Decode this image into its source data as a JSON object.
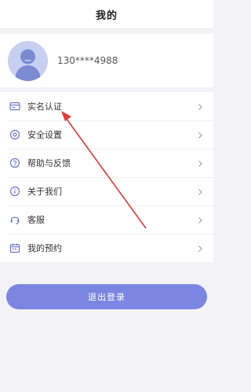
{
  "header": {
    "title": "我的"
  },
  "profile": {
    "phone": "130****4988"
  },
  "menu": {
    "items": [
      {
        "label": "实名认证",
        "icon": "id-card-icon"
      },
      {
        "label": "安全设置",
        "icon": "shield-icon"
      },
      {
        "label": "帮助与反馈",
        "icon": "help-icon"
      },
      {
        "label": "关于我们",
        "icon": "info-icon"
      },
      {
        "label": "客服",
        "icon": "headset-icon"
      },
      {
        "label": "我的预约",
        "icon": "calendar-icon"
      }
    ]
  },
  "actions": {
    "logout_label": "退出登录"
  },
  "colors": {
    "accent": "#7b86e3",
    "annotation": "#e53935",
    "avatar_bg": "#c7d0f0"
  }
}
